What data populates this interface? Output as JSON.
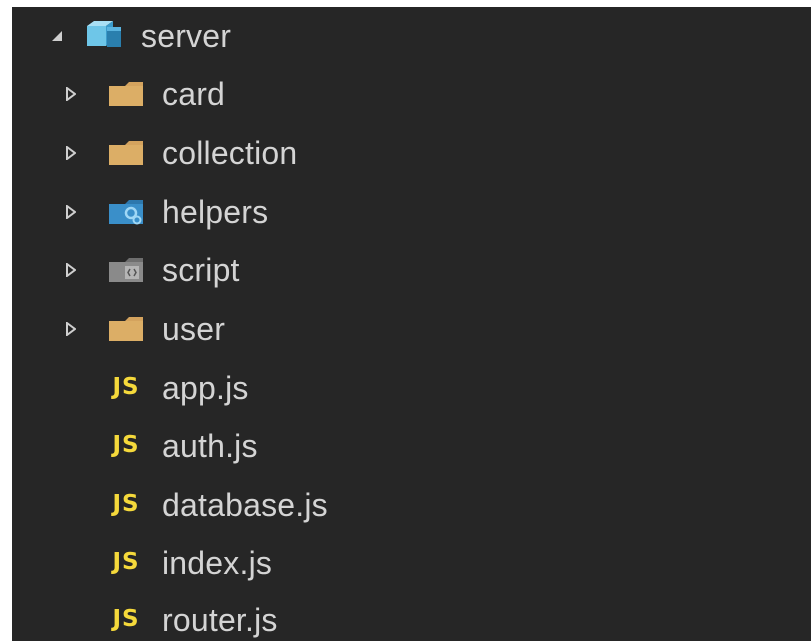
{
  "panel": {
    "background": "#262626",
    "text_color": "#d4d4d4"
  },
  "root": {
    "label": "server",
    "expanded": true,
    "icon": "server-folder-icon",
    "icon_color": "#6ec6e8"
  },
  "folders": [
    {
      "label": "card",
      "icon": "folder-icon",
      "expanded": false,
      "color": "#d4a35e"
    },
    {
      "label": "collection",
      "icon": "folder-icon",
      "expanded": false,
      "color": "#d4a35e"
    },
    {
      "label": "helpers",
      "icon": "helpers-folder-icon",
      "expanded": false,
      "color": "#3a8fc9"
    },
    {
      "label": "script",
      "icon": "script-folder-icon",
      "expanded": false,
      "color": "#8a8a8a"
    },
    {
      "label": "user",
      "icon": "folder-icon",
      "expanded": false,
      "color": "#d4a35e"
    }
  ],
  "files": [
    {
      "label": "app.js",
      "badge": "JS"
    },
    {
      "label": "auth.js",
      "badge": "JS"
    },
    {
      "label": "database.js",
      "badge": "JS"
    },
    {
      "label": "index.js",
      "badge": "JS"
    },
    {
      "label": "router.js",
      "badge": "JS"
    }
  ],
  "js_badge_color": "#f5d93b"
}
